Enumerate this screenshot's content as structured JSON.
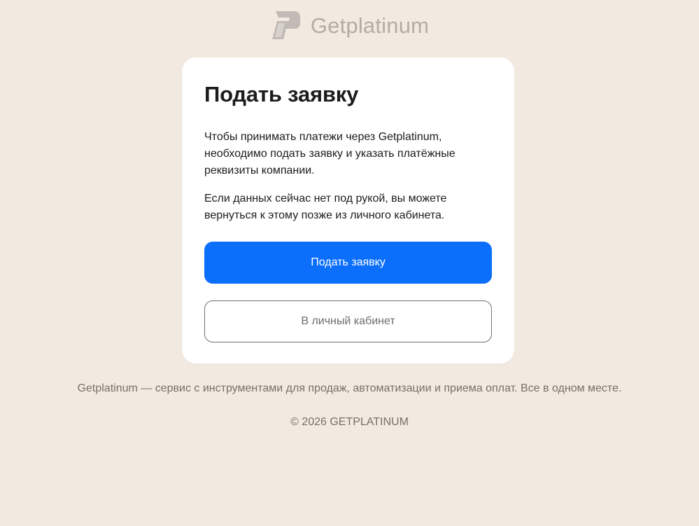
{
  "brand": {
    "name": "Getplatinum",
    "logo_icon": "getplatinum-logo-icon",
    "logo_color": "#c2bbb5",
    "name_color": "#b4aca6"
  },
  "card": {
    "title": "Подать заявку",
    "paragraph_1": "Чтобы принимать платежи через Getplatinum, необходимо подать заявку и указать платёжные реквизиты компании.",
    "paragraph_2": "Если данных сейчас нет под рукой, вы можете вернуться к этому позже из личного кабинета.",
    "primary_button": "Подать заявку",
    "secondary_button": "В личный кабинет"
  },
  "footer": {
    "description": "Getplatinum — сервис с инструментами для продаж, автоматизации и приема оплат. Все в одном месте.",
    "copyright": "© 2026 GETPLATINUM"
  },
  "colors": {
    "background": "#f2e9e0",
    "card": "#ffffff",
    "accent": "#0b6ffc",
    "footer_text": "#757169"
  }
}
